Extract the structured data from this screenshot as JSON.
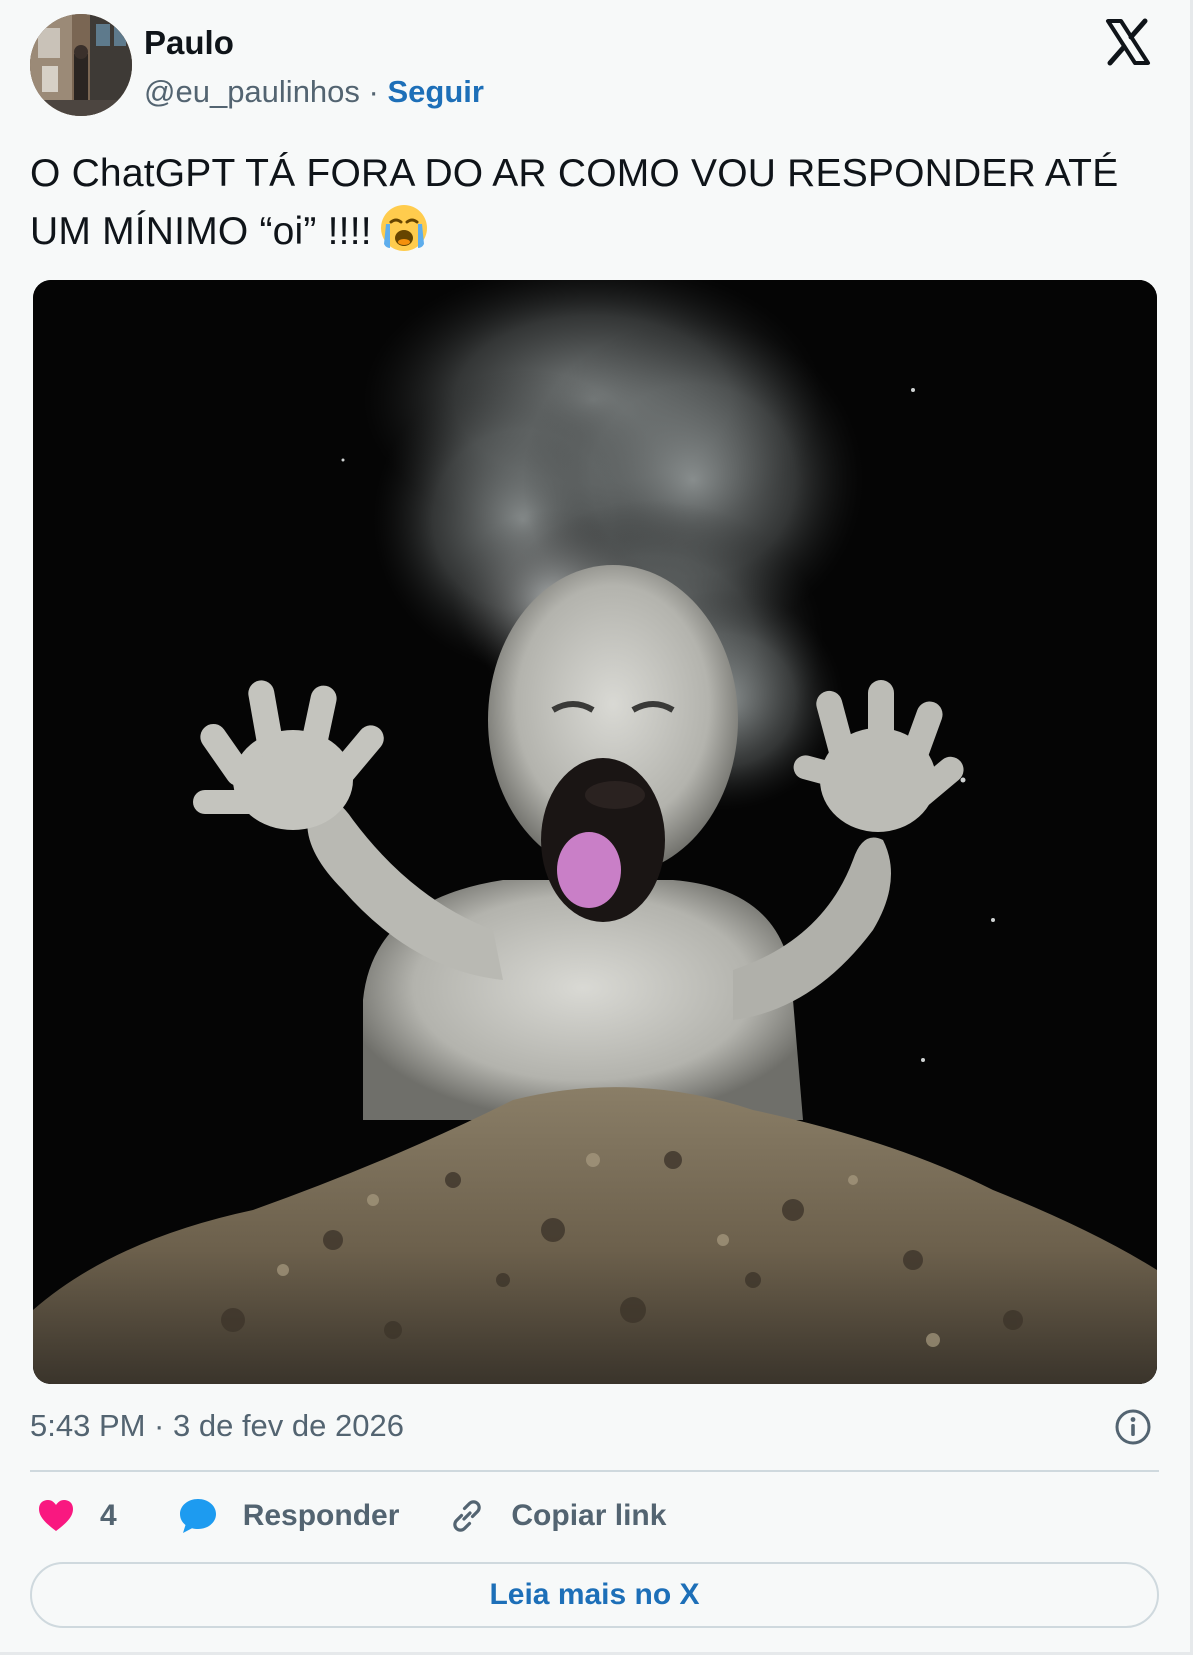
{
  "author": {
    "name": "Paulo",
    "handle": "@eu_paulinhos",
    "separator": " · ",
    "follow_label": "Seguir"
  },
  "tweet": {
    "text": "O ChatGPT TÁ FORA DO AR COMO VOU RESPONDER ATÉ UM MÍNIMO “oi” !!!!",
    "emoji": "loudly-crying-face"
  },
  "media": {
    "icon": "image-screaming-dust-baby"
  },
  "meta": {
    "timestamp": "5:43 PM · 3 de fev de 2026"
  },
  "actions": {
    "like_count": "4",
    "reply_label": "Responder",
    "copy_label": "Copiar link"
  },
  "read_more_label": "Leia mais no X",
  "colors": {
    "accent": "#1d6fb8",
    "like": "#f91880",
    "reply": "#1d9bf0",
    "secondary_text": "#536471",
    "card_bg": "#f7f9f9"
  }
}
